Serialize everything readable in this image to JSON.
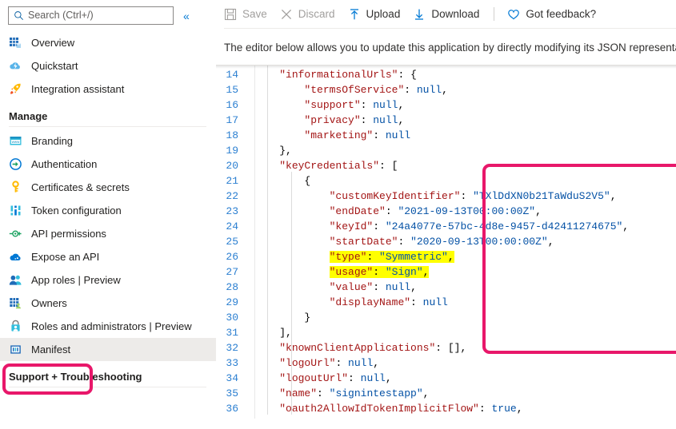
{
  "sidebar": {
    "search": {
      "placeholder": "Search (Ctrl+/)",
      "value": "",
      "icon": "search-icon"
    },
    "collapse_label": "«",
    "items": [
      {
        "label": "Overview",
        "icon": "grid-overview-icon"
      },
      {
        "label": "Quickstart",
        "icon": "cloud-lightning-icon"
      },
      {
        "label": "Integration assistant",
        "icon": "rocket-icon"
      }
    ],
    "manage_group": "Manage",
    "manage_items": [
      {
        "label": "Branding",
        "icon": "browser-window-icon"
      },
      {
        "label": "Authentication",
        "icon": "arrow-in-circle-icon"
      },
      {
        "label": "Certificates & secrets",
        "icon": "key-icon"
      },
      {
        "label": "Token configuration",
        "icon": "sliders-icon"
      },
      {
        "label": "API permissions",
        "icon": "api-plug-icon"
      },
      {
        "label": "Expose an API",
        "icon": "cloud-icon"
      },
      {
        "label": "App roles | Preview",
        "icon": "people-icon"
      },
      {
        "label": "Owners",
        "icon": "grid-person-icon"
      },
      {
        "label": "Roles and administrators | Preview",
        "icon": "lock-person-icon"
      },
      {
        "label": "Manifest",
        "icon": "manifest-document-icon",
        "selected": true
      }
    ],
    "support_group": "Support + Troubleshooting"
  },
  "toolbar": {
    "buttons": [
      {
        "label": "Save",
        "icon": "save-disk-icon",
        "disabled": true
      },
      {
        "label": "Discard",
        "icon": "close-x-icon",
        "disabled": true
      },
      {
        "label": "Upload",
        "icon": "upload-arrow-icon",
        "disabled": false
      },
      {
        "label": "Download",
        "icon": "download-arrow-icon",
        "disabled": false
      },
      {
        "label": "Got feedback?",
        "icon": "heart-icon",
        "disabled": false
      }
    ]
  },
  "main": {
    "description": "The editor below allows you to update this application by directly modifying its JSON representatio"
  },
  "colors": {
    "accent": "#0078d4",
    "annotation": "#e8176a",
    "highlight": "#ffff00",
    "json_key": "#a31515",
    "json_value": "#0451a5",
    "line_number": "#2b7fd1"
  },
  "editor": {
    "first_line_number": 14,
    "lines": [
      {
        "n": 14,
        "indent": 1,
        "tokens": [
          {
            "t": "\"informationalUrls\"",
            "c": "k"
          },
          {
            "t": ": ",
            "c": "p"
          },
          {
            "t": "{",
            "c": "p"
          }
        ]
      },
      {
        "n": 15,
        "indent": 2,
        "tokens": [
          {
            "t": "\"termsOfService\"",
            "c": "k"
          },
          {
            "t": ": ",
            "c": "p"
          },
          {
            "t": "null",
            "c": "n"
          },
          {
            "t": ",",
            "c": "p"
          }
        ]
      },
      {
        "n": 16,
        "indent": 2,
        "tokens": [
          {
            "t": "\"support\"",
            "c": "k"
          },
          {
            "t": ": ",
            "c": "p"
          },
          {
            "t": "null",
            "c": "n"
          },
          {
            "t": ",",
            "c": "p"
          }
        ]
      },
      {
        "n": 17,
        "indent": 2,
        "tokens": [
          {
            "t": "\"privacy\"",
            "c": "k"
          },
          {
            "t": ": ",
            "c": "p"
          },
          {
            "t": "null",
            "c": "n"
          },
          {
            "t": ",",
            "c": "p"
          }
        ]
      },
      {
        "n": 18,
        "indent": 2,
        "tokens": [
          {
            "t": "\"marketing\"",
            "c": "k"
          },
          {
            "t": ": ",
            "c": "p"
          },
          {
            "t": "null",
            "c": "n"
          }
        ]
      },
      {
        "n": 19,
        "indent": 1,
        "tokens": [
          {
            "t": "},",
            "c": "p"
          }
        ]
      },
      {
        "n": 20,
        "indent": 1,
        "tokens": [
          {
            "t": "\"keyCredentials\"",
            "c": "k"
          },
          {
            "t": ": ",
            "c": "p"
          },
          {
            "t": "[",
            "c": "p"
          }
        ]
      },
      {
        "n": 21,
        "indent": 2,
        "tokens": [
          {
            "t": "{",
            "c": "p"
          }
        ]
      },
      {
        "n": 22,
        "indent": 3,
        "tokens": [
          {
            "t": "\"customKeyIdentifier\"",
            "c": "k"
          },
          {
            "t": ": ",
            "c": "p"
          },
          {
            "t": "\"TXlDdXN0b21TaWduS2V5\"",
            "c": "s"
          },
          {
            "t": ",",
            "c": "p"
          }
        ]
      },
      {
        "n": 23,
        "indent": 3,
        "tokens": [
          {
            "t": "\"endDate\"",
            "c": "k"
          },
          {
            "t": ": ",
            "c": "p"
          },
          {
            "t": "\"2021-09-13T00:00:00Z\"",
            "c": "s"
          },
          {
            "t": ",",
            "c": "p"
          }
        ]
      },
      {
        "n": 24,
        "indent": 3,
        "tokens": [
          {
            "t": "\"keyId\"",
            "c": "k"
          },
          {
            "t": ": ",
            "c": "p"
          },
          {
            "t": "\"24a4077e-57bc-4d8e-9457-d42411274675\"",
            "c": "s"
          },
          {
            "t": ",",
            "c": "p"
          }
        ]
      },
      {
        "n": 25,
        "indent": 3,
        "tokens": [
          {
            "t": "\"startDate\"",
            "c": "k"
          },
          {
            "t": ": ",
            "c": "p"
          },
          {
            "t": "\"2020-09-13T00:00:00Z\"",
            "c": "s"
          },
          {
            "t": ",",
            "c": "p"
          }
        ]
      },
      {
        "n": 26,
        "indent": 3,
        "highlight": true,
        "tokens": [
          {
            "t": "\"type\"",
            "c": "k"
          },
          {
            "t": ": ",
            "c": "p"
          },
          {
            "t": "\"Symmetric\"",
            "c": "s"
          },
          {
            "t": ",",
            "c": "p"
          }
        ]
      },
      {
        "n": 27,
        "indent": 3,
        "highlight": true,
        "tokens": [
          {
            "t": "\"usage\"",
            "c": "k"
          },
          {
            "t": ": ",
            "c": "p"
          },
          {
            "t": "\"Sign\"",
            "c": "s"
          },
          {
            "t": ",",
            "c": "p"
          }
        ]
      },
      {
        "n": 28,
        "indent": 3,
        "tokens": [
          {
            "t": "\"value\"",
            "c": "k"
          },
          {
            "t": ": ",
            "c": "p"
          },
          {
            "t": "null",
            "c": "n"
          },
          {
            "t": ",",
            "c": "p"
          }
        ]
      },
      {
        "n": 29,
        "indent": 3,
        "tokens": [
          {
            "t": "\"displayName\"",
            "c": "k"
          },
          {
            "t": ": ",
            "c": "p"
          },
          {
            "t": "null",
            "c": "n"
          }
        ]
      },
      {
        "n": 30,
        "indent": 2,
        "tokens": [
          {
            "t": "}",
            "c": "p"
          }
        ]
      },
      {
        "n": 31,
        "indent": 1,
        "tokens": [
          {
            "t": "],",
            "c": "p"
          }
        ]
      },
      {
        "n": 32,
        "indent": 1,
        "tokens": [
          {
            "t": "\"knownClientApplications\"",
            "c": "k"
          },
          {
            "t": ": ",
            "c": "p"
          },
          {
            "t": "[],",
            "c": "p"
          }
        ]
      },
      {
        "n": 33,
        "indent": 1,
        "tokens": [
          {
            "t": "\"logoUrl\"",
            "c": "k"
          },
          {
            "t": ": ",
            "c": "p"
          },
          {
            "t": "null",
            "c": "n"
          },
          {
            "t": ",",
            "c": "p"
          }
        ]
      },
      {
        "n": 34,
        "indent": 1,
        "tokens": [
          {
            "t": "\"logoutUrl\"",
            "c": "k"
          },
          {
            "t": ": ",
            "c": "p"
          },
          {
            "t": "null",
            "c": "n"
          },
          {
            "t": ",",
            "c": "p"
          }
        ]
      },
      {
        "n": 35,
        "indent": 1,
        "tokens": [
          {
            "t": "\"name\"",
            "c": "k"
          },
          {
            "t": ": ",
            "c": "p"
          },
          {
            "t": "\"signintestapp\"",
            "c": "s"
          },
          {
            "t": ",",
            "c": "p"
          }
        ]
      },
      {
        "n": 36,
        "indent": 1,
        "tokens": [
          {
            "t": "\"oauth2AllowIdTokenImplicitFlow\"",
            "c": "k"
          },
          {
            "t": ": ",
            "c": "p"
          },
          {
            "t": "true",
            "c": "b"
          },
          {
            "t": ",",
            "c": "p"
          }
        ]
      }
    ]
  }
}
